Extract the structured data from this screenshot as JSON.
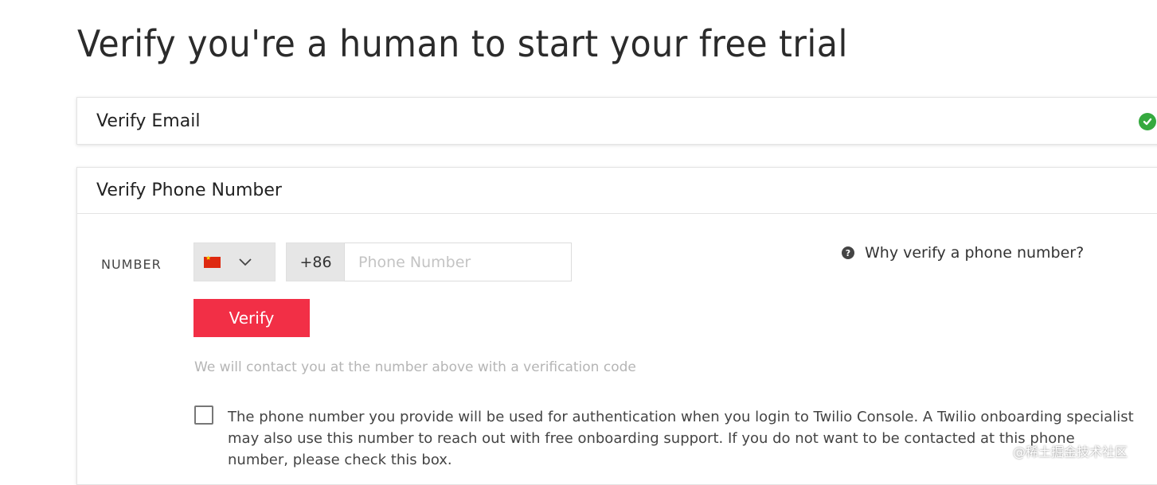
{
  "page": {
    "title": "Verify you're a human to start your free trial"
  },
  "email_section": {
    "title": "Verify Email",
    "status_icon": "check-circle-icon",
    "status_color": "#36a93f"
  },
  "phone_section": {
    "title": "Verify Phone Number",
    "number_label": "NUMBER",
    "country_flag": "china-flag-icon",
    "dial_code": "+86",
    "phone_input": {
      "value": "",
      "placeholder": "Phone Number"
    },
    "help_link": "Why verify a phone number?",
    "verify_button": "Verify",
    "hint": "We will contact you at the number above with a verification code",
    "consent_checked": false,
    "consent_text": "The phone number you provide will be used for authentication when you login to Twilio Console. A Twilio onboarding specialist may also use this number to reach out with free onboarding support. If you do not want to be contacted at this phone number, please check this box."
  },
  "watermark": "@稀土掘金技术社区",
  "colors": {
    "accent": "#f22f46",
    "success": "#36a93f"
  }
}
